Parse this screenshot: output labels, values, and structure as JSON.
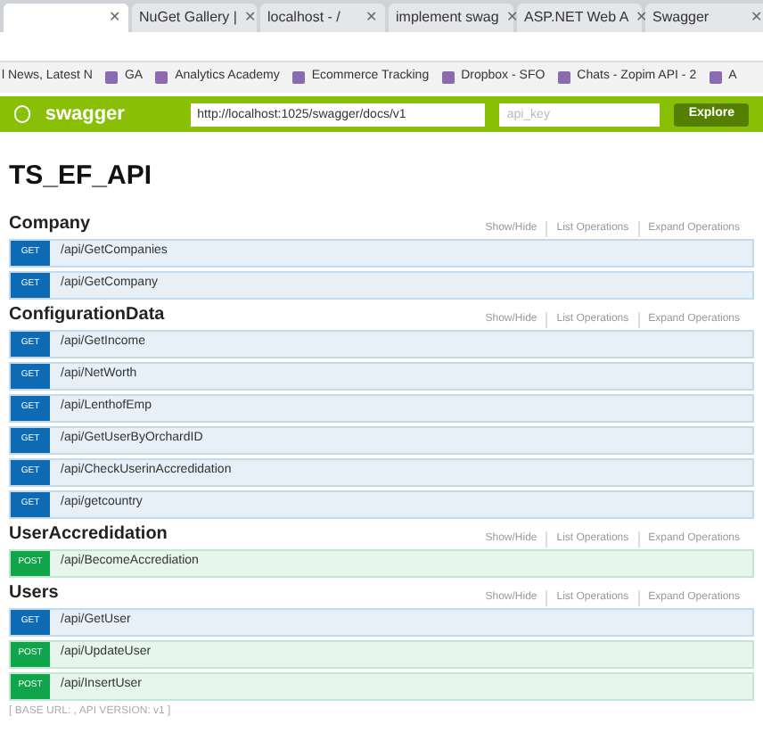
{
  "browser_tabs": [
    {
      "close": "✕",
      "selected": true
    },
    {
      "title": "NuGet Gallery |",
      "close": "✕",
      "selected": false
    },
    {
      "title": "localhost - /",
      "close": "✕",
      "selected": false
    },
    {
      "title": "implement swag",
      "close": "✕",
      "selected": false
    },
    {
      "title": "ASP.NET Web A",
      "close": "✕",
      "selected": false
    },
    {
      "title": "Swagger",
      "close": "✕",
      "selected": false
    }
  ],
  "bookmarks": [
    "l News, Latest N",
    "GA",
    "Analytics Academy",
    "Ecommerce Tracking",
    "Dropbox - SFO",
    "Chats - Zopim API - 2",
    "A"
  ],
  "swagger_header": {
    "logo": "swagger",
    "url": "http://localhost:1025/swagger/docs/v1",
    "api_key_placeholder": "api_key",
    "explore": "Explore"
  },
  "title": "TS_EF_API",
  "sections": [
    {
      "name": "Company",
      "links": [
        "Show/Hide",
        "List Operations",
        "Expand Operations"
      ],
      "operations": [
        {
          "kind": "get",
          "method": "GET",
          "path": "/api/GetCompanies"
        },
        {
          "kind": "get",
          "method": "GET",
          "path": "/api/GetCompany"
        }
      ]
    },
    {
      "name": "ConfigurationData",
      "links": [
        "Show/Hide",
        "List Operations",
        "Expand Operations"
      ],
      "operations": [
        {
          "kind": "get",
          "method": "GET",
          "path": "/api/GetIncome"
        },
        {
          "kind": "get",
          "method": "GET",
          "path": "/api/NetWorth"
        },
        {
          "kind": "get",
          "method": "GET",
          "path": "/api/LenthofEmp"
        },
        {
          "kind": "get",
          "method": "GET",
          "path": "/api/GetUserByOrchardID"
        },
        {
          "kind": "get",
          "method": "GET",
          "path": "/api/CheckUserinAccredidation"
        },
        {
          "kind": "get",
          "method": "GET",
          "path": "/api/getcountry"
        }
      ]
    },
    {
      "name": "UserAccredidation",
      "links": [
        "Show/Hide",
        "List Operations",
        "Expand Operations"
      ],
      "operations": [
        {
          "kind": "post",
          "method": "POST",
          "path": "/api/BecomeAccrediation"
        }
      ]
    },
    {
      "name": "Users",
      "links": [
        "Show/Hide",
        "List Operations",
        "Expand Operations"
      ],
      "operations": [
        {
          "kind": "get",
          "method": "GET",
          "path": "/api/GetUser"
        },
        {
          "kind": "post",
          "method": "POST",
          "path": "/api/UpdateUser"
        },
        {
          "kind": "post",
          "method": "POST",
          "path": "/api/InsertUser"
        }
      ]
    }
  ],
  "footer": "[ BASE URL: , API VERSION: v1 ]"
}
